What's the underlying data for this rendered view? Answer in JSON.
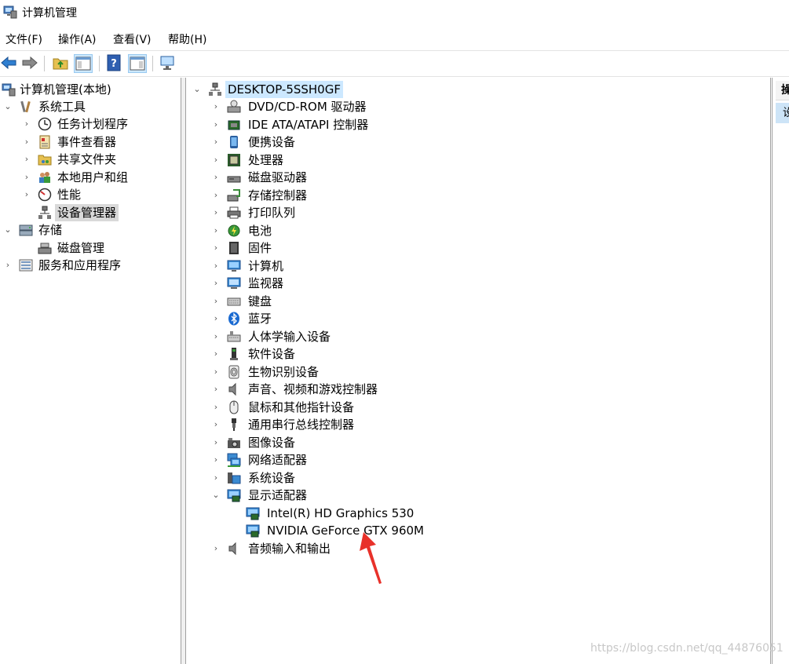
{
  "window": {
    "title": "计算机管理"
  },
  "menu": [
    "文件(F)",
    "操作(A)",
    "查看(V)",
    "帮助(H)"
  ],
  "toolbar": {
    "buttons": [
      "back-icon",
      "forward-icon",
      "up-folder-icon",
      "show-hide-tree-icon",
      "help-icon",
      "properties-icon",
      "monitor-icon"
    ]
  },
  "left_tree": {
    "root": "计算机管理(本地)",
    "system_tools": "系统工具",
    "task_scheduler": "任务计划程序",
    "event_viewer": "事件查看器",
    "shared_folders": "共享文件夹",
    "local_users": "本地用户和组",
    "performance": "性能",
    "device_manager": "设备管理器",
    "storage": "存储",
    "disk_management": "磁盘管理",
    "services": "服务和应用程序"
  },
  "device_tree": {
    "root": "DESKTOP-5SSH0GF",
    "categories": [
      "DVD/CD-ROM 驱动器",
      "IDE ATA/ATAPI 控制器",
      "便携设备",
      "处理器",
      "磁盘驱动器",
      "存储控制器",
      "打印队列",
      "电池",
      "固件",
      "计算机",
      "监视器",
      "键盘",
      "蓝牙",
      "人体学输入设备",
      "软件设备",
      "生物识别设备",
      "声音、视频和游戏控制器",
      "鼠标和其他指针设备",
      "通用串行总线控制器",
      "图像设备",
      "网络适配器",
      "系统设备",
      "显示适配器"
    ],
    "display_adapters": [
      "Intel(R) HD Graphics 530",
      "NVIDIA GeForce GTX 960M"
    ],
    "last_category": "音频输入和输出"
  },
  "right_pane": {
    "header": "操",
    "item": "设"
  },
  "watermark": "https://blog.csdn.net/qq_44876051",
  "colors": {
    "selection": "#cce8ff",
    "tree_selected": "#d9d9d9",
    "arrow": "#e8312a"
  }
}
